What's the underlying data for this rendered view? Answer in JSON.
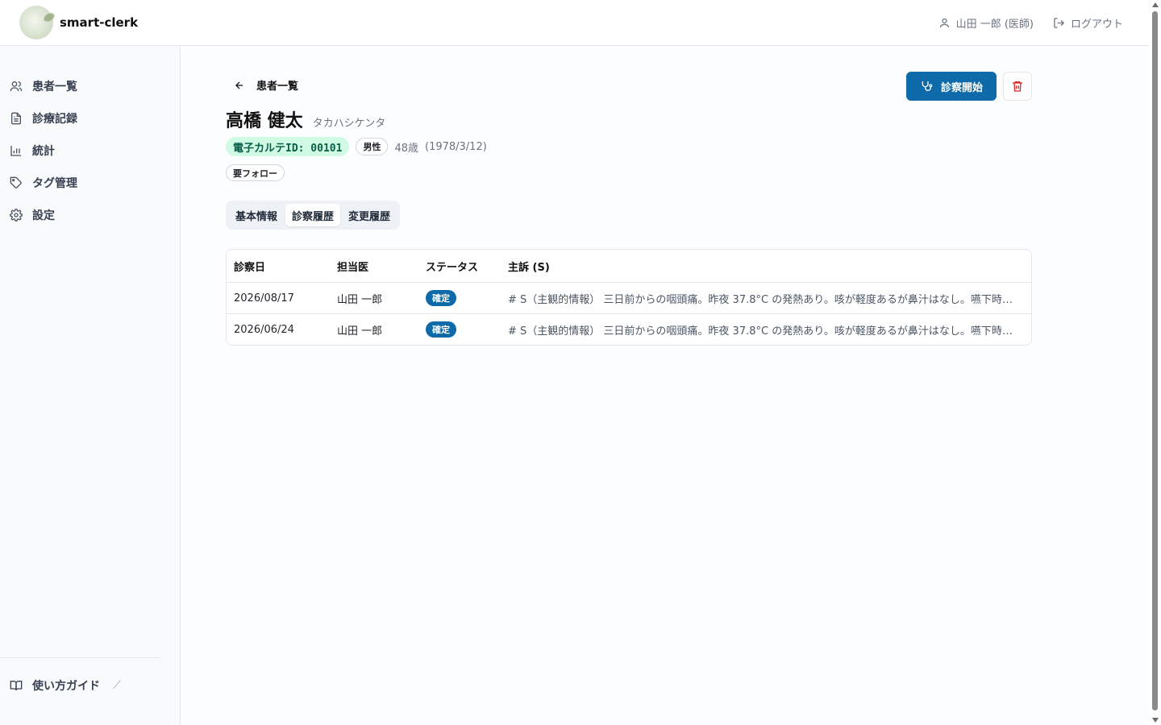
{
  "header": {
    "app_name": "smart-clerk",
    "user_label": "山田 一郎 (医師)",
    "logout_label": "ログアウト"
  },
  "sidebar": {
    "items": [
      {
        "label": "患者一覧",
        "icon": "users-icon"
      },
      {
        "label": "診療記録",
        "icon": "document-icon"
      },
      {
        "label": "統計",
        "icon": "bar-chart-icon"
      },
      {
        "label": "タグ管理",
        "icon": "tag-icon"
      },
      {
        "label": "設定",
        "icon": "gear-icon"
      }
    ],
    "guide_label": "使い方ガイド"
  },
  "patient": {
    "back_label": "患者一覧",
    "name": "高橋 健太",
    "kana": "タカハシケンタ",
    "emr_id": "電子カルテID: 00101",
    "gender": "男性",
    "age": "48歳",
    "birthdate": "(1978/3/12)",
    "tags": [
      "要フォロー"
    ]
  },
  "actions": {
    "start_exam_label": "診察開始"
  },
  "tabs": [
    {
      "label": "基本情報",
      "active": false
    },
    {
      "label": "診察履歴",
      "active": true
    },
    {
      "label": "変更履歴",
      "active": false
    }
  ],
  "table": {
    "headers": [
      "診察日",
      "担当医",
      "ステータス",
      "主訴 (S)"
    ],
    "rows": [
      {
        "date": "2026/08/17",
        "doctor": "山田 一郎",
        "status": "確定",
        "complaint": "# S（主観的情報） 三日前からの咽頭痛。昨夜 37.8°C の発熱あり。咳が軽度あるが鼻汁はなし。嚥下時痛は強く、食事摂取量が低下している。"
      },
      {
        "date": "2026/06/24",
        "doctor": "山田 一郎",
        "status": "確定",
        "complaint": "# S（主観的情報） 三日前からの咽頭痛。昨夜 37.8°C の発熱あり。咳が軽度あるが鼻汁はなし。嚥下時痛は強く、食事摂取量が低下している。"
      }
    ]
  },
  "colors": {
    "primary": "#0e6aa8",
    "id_badge_bg": "#d1fae5",
    "delete": "#dc2626"
  }
}
